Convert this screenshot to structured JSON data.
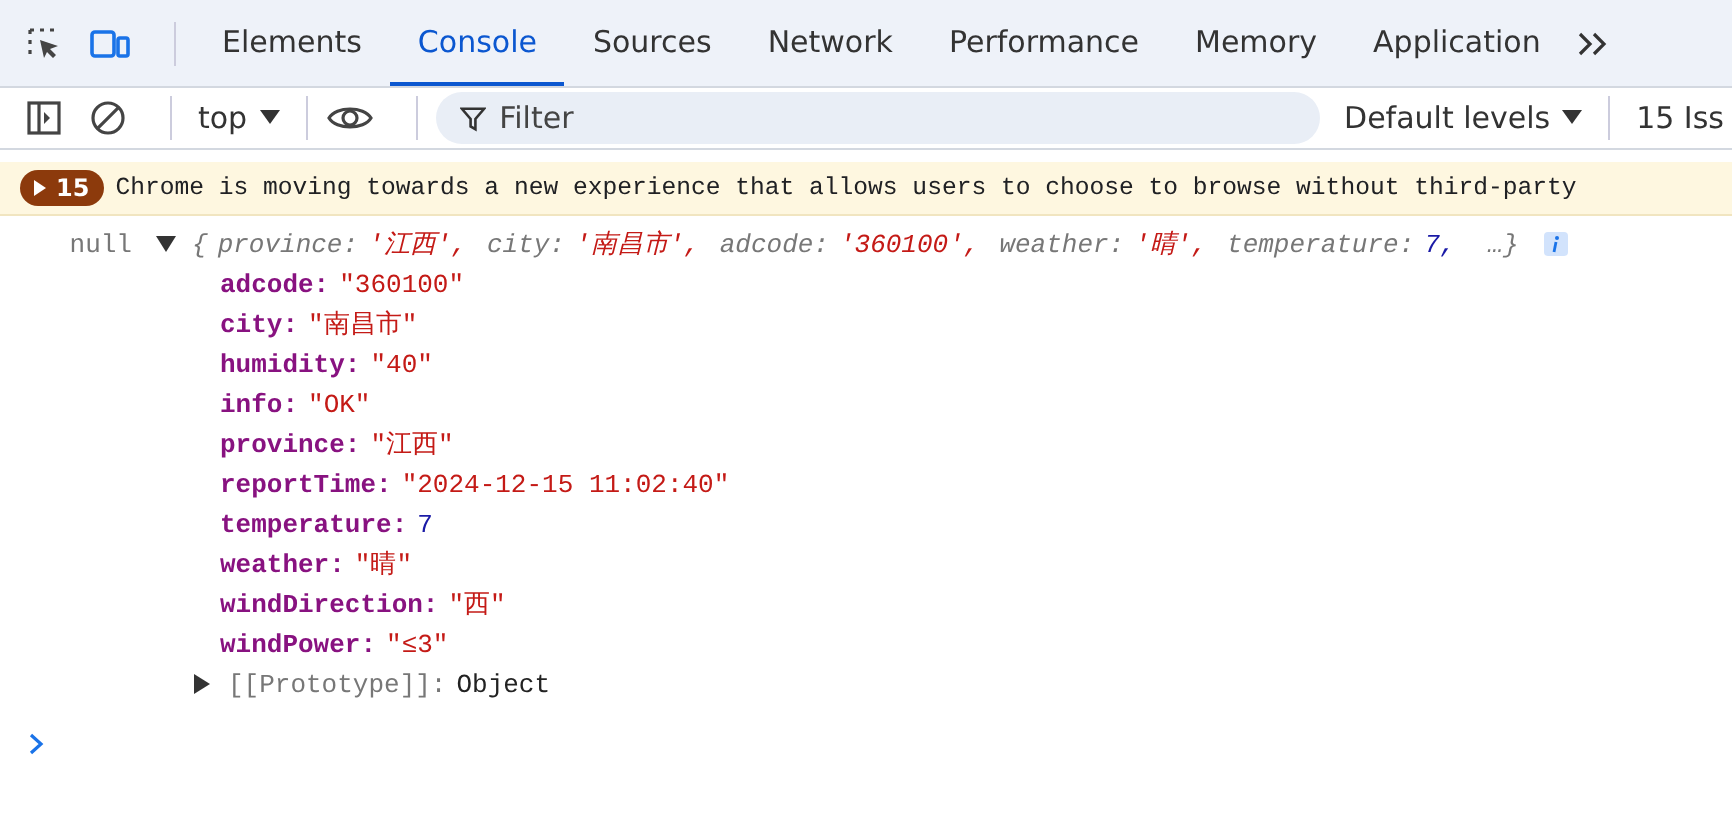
{
  "tabs": [
    {
      "label": "Elements",
      "selected": false
    },
    {
      "label": "Console",
      "selected": true
    },
    {
      "label": "Sources",
      "selected": false
    },
    {
      "label": "Network",
      "selected": false
    },
    {
      "label": "Performance",
      "selected": false
    },
    {
      "label": "Memory",
      "selected": false
    },
    {
      "label": "Application",
      "selected": false
    }
  ],
  "toolbar": {
    "context": "top",
    "filter": {
      "placeholder": "Filter"
    },
    "levels": "Default levels",
    "issues": "15 Iss"
  },
  "banner": {
    "count": "15",
    "message": "Chrome is moving towards a new experience that allows users to choose to browse without third-party"
  },
  "log": {
    "prefix": "null",
    "expanded": true,
    "open": "{",
    "close": "…}",
    "preview": [
      {
        "key": "province:",
        "value": "'江西',",
        "kind": "string"
      },
      {
        "key": "city:",
        "value": "'南昌市',",
        "kind": "string"
      },
      {
        "key": "adcode:",
        "value": "'360100',",
        "kind": "string"
      },
      {
        "key": "weather:",
        "value": "'晴',",
        "kind": "string"
      },
      {
        "key": "temperature:",
        "value": "7,",
        "kind": "number"
      }
    ],
    "properties": [
      {
        "key": "adcode:",
        "value": "\"360100\"",
        "kind": "string"
      },
      {
        "key": "city:",
        "value": "\"南昌市\"",
        "kind": "string"
      },
      {
        "key": "humidity:",
        "value": "\"40\"",
        "kind": "string"
      },
      {
        "key": "info:",
        "value": "\"OK\"",
        "kind": "string"
      },
      {
        "key": "province:",
        "value": "\"江西\"",
        "kind": "string"
      },
      {
        "key": "reportTime:",
        "value": "\"2024-12-15 11:02:40\"",
        "kind": "string"
      },
      {
        "key": "temperature:",
        "value": "7",
        "kind": "number"
      },
      {
        "key": "weather:",
        "value": "\"晴\"",
        "kind": "string"
      },
      {
        "key": "windDirection:",
        "value": "\"西\"",
        "kind": "string"
      },
      {
        "key": "windPower:",
        "value": "\"≤3\"",
        "kind": "string"
      }
    ],
    "prototype": {
      "key": "[[Prototype]]:",
      "value": "Object",
      "expanded": false
    }
  }
}
